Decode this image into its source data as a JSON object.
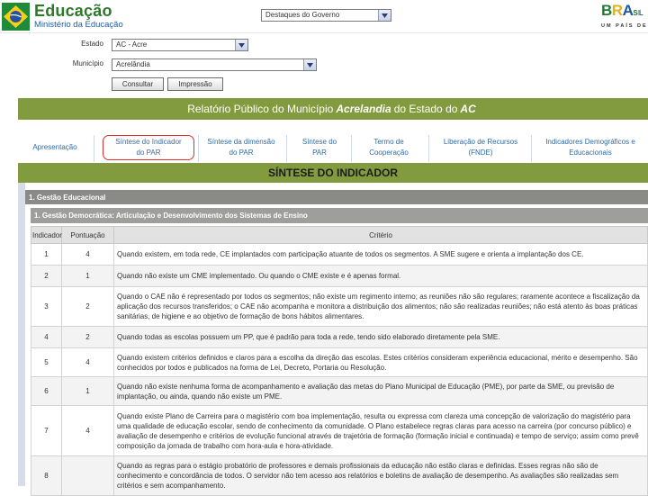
{
  "header": {
    "brand_title": "Educação",
    "brand_subtitle": "Ministério da Educação",
    "highlights_select": "Destaques do Governo",
    "brasil_letters": [
      "B",
      "R",
      "A",
      "S",
      "I",
      "L"
    ],
    "brasil_tagline": "UM PAÍS DE TODOS"
  },
  "filters": {
    "state_label": "Estado",
    "state_value": "AC - Acre",
    "municipality_label": "Município",
    "municipality_value": "Acrelândia",
    "consult_button": "Consultar",
    "print_button": "Impressão"
  },
  "report": {
    "title_prefix": "Relatório Público do Município",
    "municipality": "Acrelandia",
    "title_middle": "do Estado do",
    "state": "AC"
  },
  "tabs": [
    {
      "line1": "Apresentação",
      "line2": ""
    },
    {
      "line1": "Síntese do Indicador",
      "line2": "do PAR"
    },
    {
      "line1": "Síntese da dimensão",
      "line2": "do PAR"
    },
    {
      "line1": "Síntese do",
      "line2": "PAR"
    },
    {
      "line1": "Termo de",
      "line2": "Cooperação"
    },
    {
      "line1": "Liberação de Recursos",
      "line2": "(FNDE)"
    },
    {
      "line1": "Indicadores Demográficos e",
      "line2": "Educacionais"
    }
  ],
  "synthesis": {
    "title": "SÍNTESE DO INDICADOR",
    "section": "1. Gestão Educacional",
    "subsection": "1. Gestão Democrática: Articulação e Desenvolvimento dos Sistemas de Ensino"
  },
  "table": {
    "headers": {
      "indicator": "Indicador",
      "score": "Pontuação",
      "criterion": "Critério"
    },
    "rows": [
      {
        "indicator": "1",
        "score": "4",
        "criterion": "Quando existem, em toda rede, CE implantados com participação atuante de todos os segmentos. A SME sugere e orienta a implantação dos CE."
      },
      {
        "indicator": "2",
        "score": "1",
        "criterion": "Quando não existe um CME implementado. Ou quando o CME existe e é apenas formal."
      },
      {
        "indicator": "3",
        "score": "2",
        "criterion": "Quando o CAE não é representado por todos os segmentos; não existe um regimento interno; as reuniões não são regulares; raramente acontece a fiscalização da aplicação dos recursos transferidos; o CAE não acompanha e monitora a distribuição dos alimentos; não são realizadas reuniões; não está atento às boas práticas sanitárias, de higiene e ao objetivo de formação de bons hábitos alimentares."
      },
      {
        "indicator": "4",
        "score": "2",
        "criterion": "Quando todas as escolas possuem um PP, que é padrão para toda a rede, tendo sido elaborado diretamente pela SME."
      },
      {
        "indicator": "5",
        "score": "4",
        "criterion": "Quando existem critérios definidos e claros para a escolha da direção das escolas. Estes critérios consideram experiência educacional, mérito e desempenho. São conhecidos por todos e publicados na forma de Lei, Decreto, Portaria ou Resolução."
      },
      {
        "indicator": "6",
        "score": "1",
        "criterion": "Quando não existe nenhuma forma de acompanhamento e avaliação das metas do Plano Municipal de Educação (PME), por parte da SME, ou previsão de implantação, ou ainda, quando não existe um PME."
      },
      {
        "indicator": "7",
        "score": "4",
        "criterion": "Quando existe Plano de Carreira para o magistério com boa implementação, resulta ou expressa com clareza uma concepção de valorização do magistério para uma qualidade de educação escolar, sendo de conhecimento da comunidade. O Plano estabelece regras claras para acesso na carreira (por concurso público) e avaliação de desempenho e critérios de evolução funcional através de trajetória de formação (formação inicial e continuada) e tempo de serviço; assim como prevê composição da jornada de trabalho com hora-aula e hora-atividade."
      },
      {
        "indicator": "8",
        "score": "",
        "criterion": "Quando as regras para o estágio probatório de professores e demais profissionais da educação não estão claras e definidas. Esses regras não são de conhecimento e concordância de todos. O servidor não tem acesso aos relatórios e boletins de avaliação de desempenho. As avaliações são realizadas sem critérios e sem acompanhamento."
      }
    ]
  }
}
